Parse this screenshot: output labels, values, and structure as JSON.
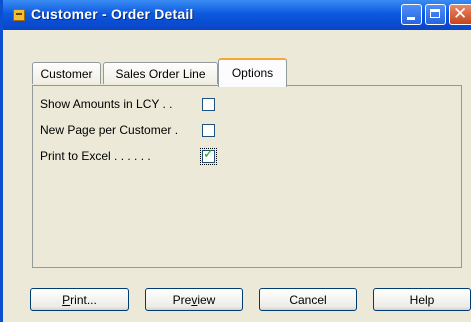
{
  "window": {
    "title": "Customer - Order Detail"
  },
  "tabs": [
    {
      "label": "Customer",
      "active": false
    },
    {
      "label": "Sales Order Line",
      "active": false
    },
    {
      "label": "Options",
      "active": true
    }
  ],
  "options": [
    {
      "label": "Show Amounts in LCY . .",
      "checked": false
    },
    {
      "label": "New Page per Customer .",
      "checked": false
    },
    {
      "label": "Print to Excel . . . . . .",
      "checked": true
    }
  ],
  "buttons": {
    "print": {
      "underlined": "P",
      "rest": "rint..."
    },
    "preview": {
      "prefix": "Pre",
      "underlined": "v",
      "rest": "iew"
    },
    "cancel": "Cancel",
    "help": "Help"
  },
  "colors": {
    "titlebar": "#0a4fd6",
    "active_tab_highlight": "#f7a830",
    "checkmark": "#21a121"
  }
}
